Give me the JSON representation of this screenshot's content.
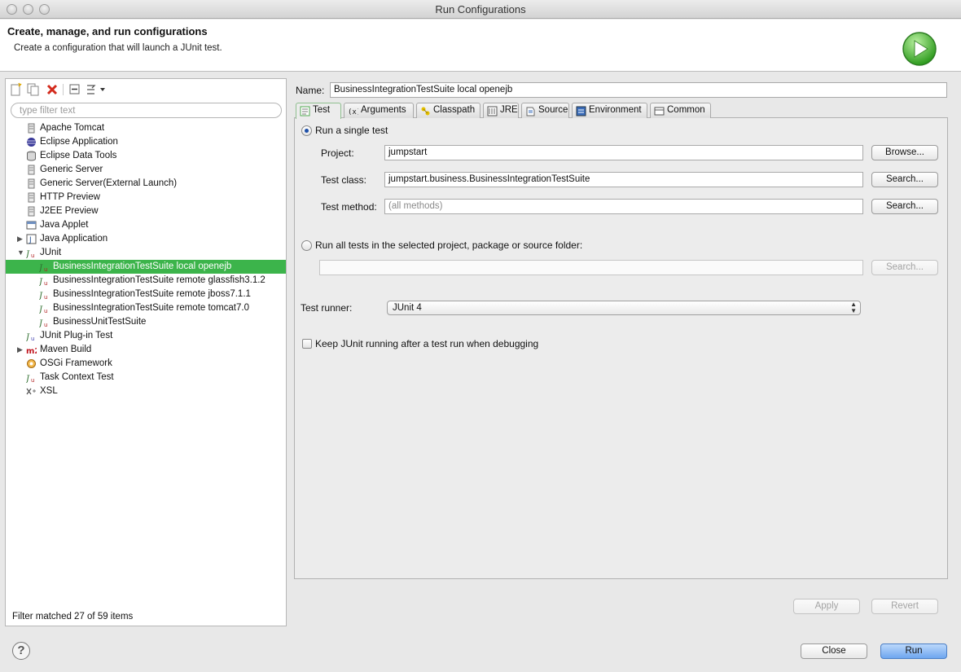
{
  "window": {
    "title": "Run Configurations"
  },
  "header": {
    "title": "Create, manage, and run configurations",
    "subtitle": "Create a configuration that will launch a JUnit test."
  },
  "left": {
    "filter_placeholder": "type filter text",
    "tree": [
      {
        "label": "Apache Tomcat",
        "icon": "server-icon"
      },
      {
        "label": "Eclipse Application",
        "icon": "eclipse-icon"
      },
      {
        "label": "Eclipse Data Tools",
        "icon": "database-icon"
      },
      {
        "label": "Generic Server",
        "icon": "server-icon"
      },
      {
        "label": "Generic Server(External Launch)",
        "icon": "server-icon"
      },
      {
        "label": "HTTP Preview",
        "icon": "server-icon"
      },
      {
        "label": "J2EE Preview",
        "icon": "server-icon"
      },
      {
        "label": "Java Applet",
        "icon": "applet-icon"
      },
      {
        "label": "Java Application",
        "icon": "java-app-icon"
      },
      {
        "label": "JUnit",
        "icon": "junit-icon"
      },
      {
        "label": "BusinessIntegrationTestSuite local openejb",
        "icon": "junit-icon"
      },
      {
        "label": "BusinessIntegrationTestSuite remote glassfish3.1.2",
        "icon": "junit-icon"
      },
      {
        "label": "BusinessIntegrationTestSuite remote jboss7.1.1",
        "icon": "junit-icon"
      },
      {
        "label": "BusinessIntegrationTestSuite remote tomcat7.0",
        "icon": "junit-icon"
      },
      {
        "label": "BusinessUnitTestSuite",
        "icon": "junit-icon"
      },
      {
        "label": "JUnit Plug-in Test",
        "icon": "junit-plugin-icon"
      },
      {
        "label": "Maven Build",
        "icon": "maven-icon"
      },
      {
        "label": "OSGi Framework",
        "icon": "osgi-icon"
      },
      {
        "label": "Task Context Test",
        "icon": "junit-icon"
      },
      {
        "label": "XSL",
        "icon": "xsl-icon"
      }
    ],
    "status": "Filter matched 27 of 59 items"
  },
  "right": {
    "name_label": "Name:",
    "name_value": "BusinessIntegrationTestSuite local openejb",
    "tabs": [
      {
        "label": "Test",
        "icon": "test-icon"
      },
      {
        "label": "Arguments",
        "icon": "arguments-icon"
      },
      {
        "label": "Classpath",
        "icon": "classpath-icon"
      },
      {
        "label": "JRE",
        "icon": "jre-icon"
      },
      {
        "label": "Source",
        "icon": "source-icon"
      },
      {
        "label": "Environment",
        "icon": "environment-icon"
      },
      {
        "label": "Common",
        "icon": "common-icon"
      }
    ],
    "single_test_label": "Run a single test",
    "project_label": "Project:",
    "project_value": "jumpstart",
    "browse_label": "Browse...",
    "test_class_label": "Test class:",
    "test_class_value": "jumpstart.business.BusinessIntegrationTestSuite",
    "search_label": "Search...",
    "test_method_label": "Test method:",
    "test_method_placeholder": "(all methods)",
    "all_tests_label": "Run all tests in the selected project, package or source folder:",
    "test_runner_label": "Test runner:",
    "test_runner_value": "JUnit 4",
    "keep_running_label": "Keep JUnit running after a test run when debugging",
    "apply_label": "Apply",
    "revert_label": "Revert"
  },
  "footer": {
    "help": "?",
    "close_label": "Close",
    "run_label": "Run"
  }
}
